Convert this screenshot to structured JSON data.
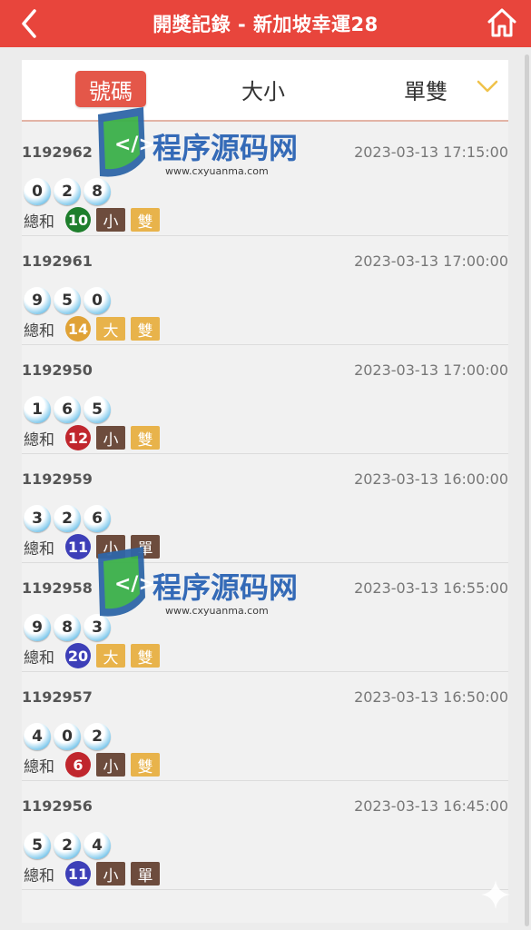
{
  "header": {
    "title": "開獎記錄 - 新加坡幸運28",
    "back_icon": "chevron-left-icon",
    "home_icon": "home-icon",
    "bg_color": "#e8453c"
  },
  "tabs": [
    {
      "label": "號碼",
      "active": true
    },
    {
      "label": "大小",
      "active": false
    },
    {
      "label": "單雙",
      "active": false
    }
  ],
  "tabs_dropdown_icon": "chevron-down-icon",
  "sum_label": "總和",
  "records": [
    {
      "issue": "1192962",
      "time": "2023-03-13 17:15:00",
      "balls": [
        "0",
        "2",
        "8"
      ],
      "sum": "10",
      "sum_color": "#1e7e2c",
      "size": "小",
      "size_color": "#6d4c3d",
      "parity": "雙",
      "parity_color": "#e8b34b"
    },
    {
      "issue": "1192961",
      "time": "2023-03-13 17:00:00",
      "balls": [
        "9",
        "5",
        "0"
      ],
      "sum": "14",
      "sum_color": "#e0a236",
      "size": "大",
      "size_color": "#e8b34b",
      "parity": "雙",
      "parity_color": "#e8b34b"
    },
    {
      "issue": "1192950",
      "time": "2023-03-13 17:00:00",
      "balls": [
        "1",
        "6",
        "5"
      ],
      "sum": "12",
      "sum_color": "#c0262d",
      "size": "小",
      "size_color": "#6d4c3d",
      "parity": "雙",
      "parity_color": "#e8b34b"
    },
    {
      "issue": "1192959",
      "time": "2023-03-13 16:00:00",
      "balls": [
        "3",
        "2",
        "6"
      ],
      "sum": "11",
      "sum_color": "#3d3fb8",
      "size": "小",
      "size_color": "#6d4c3d",
      "parity": "單",
      "parity_color": "#6d4c3d"
    },
    {
      "issue": "1192958",
      "time": "2023-03-13 16:55:00",
      "balls": [
        "9",
        "8",
        "3"
      ],
      "sum": "20",
      "sum_color": "#3d3fb8",
      "size": "大",
      "size_color": "#e8b34b",
      "parity": "雙",
      "parity_color": "#e8b34b"
    },
    {
      "issue": "1192957",
      "time": "2023-03-13 16:50:00",
      "balls": [
        "4",
        "0",
        "2"
      ],
      "sum": "6",
      "sum_color": "#c0262d",
      "size": "小",
      "size_color": "#6d4c3d",
      "parity": "雙",
      "parity_color": "#e8b34b"
    },
    {
      "issue": "1192956",
      "time": "2023-03-13 16:45:00",
      "balls": [
        "5",
        "2",
        "4"
      ],
      "sum": "11",
      "sum_color": "#3d3fb8",
      "size": "小",
      "size_color": "#6d4c3d",
      "parity": "單",
      "parity_color": "#6d4c3d"
    }
  ],
  "watermark": {
    "title": "程序源码网",
    "url": "www.cxyuanma.com"
  }
}
